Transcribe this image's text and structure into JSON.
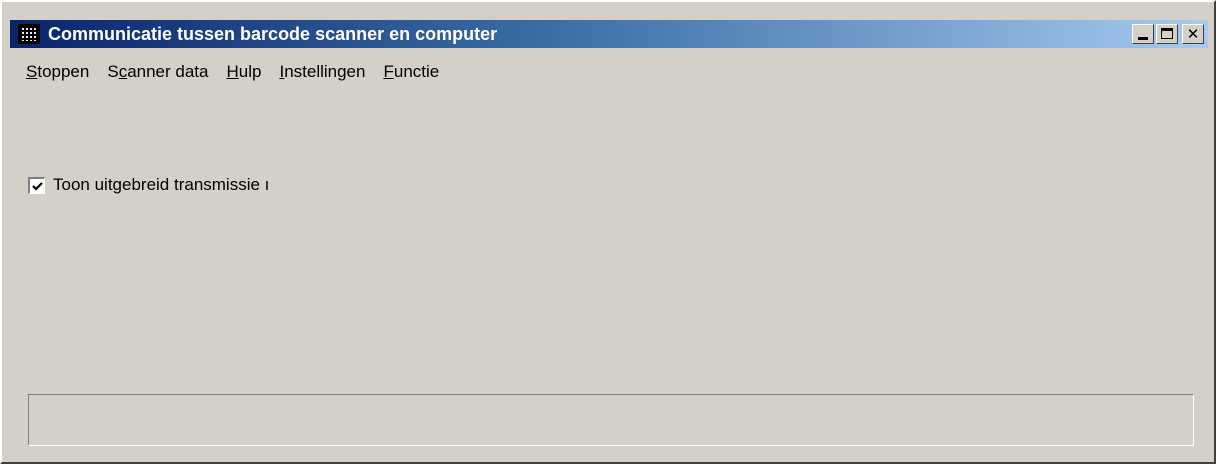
{
  "window": {
    "title": "Communicatie tussen barcode scanner en computer",
    "icon": "barcode-app-icon",
    "controls": {
      "minimize": "minimize-icon",
      "maximize": "maximize-icon",
      "close": "close-icon",
      "close_glyph": "✕"
    }
  },
  "menu": {
    "items": [
      {
        "pre": "",
        "ul": "S",
        "post": "toppen"
      },
      {
        "pre": "S",
        "ul": "c",
        "post": "anner data"
      },
      {
        "pre": "",
        "ul": "H",
        "post": "ulp"
      },
      {
        "pre": "",
        "ul": "I",
        "post": "nstellingen"
      },
      {
        "pre": "",
        "ul": "F",
        "post": "unctie"
      }
    ]
  },
  "options": {
    "show_transmission_checked": true,
    "show_transmission_label": "Toon uitgebreid transmissie ı"
  },
  "status": {
    "text": ""
  }
}
